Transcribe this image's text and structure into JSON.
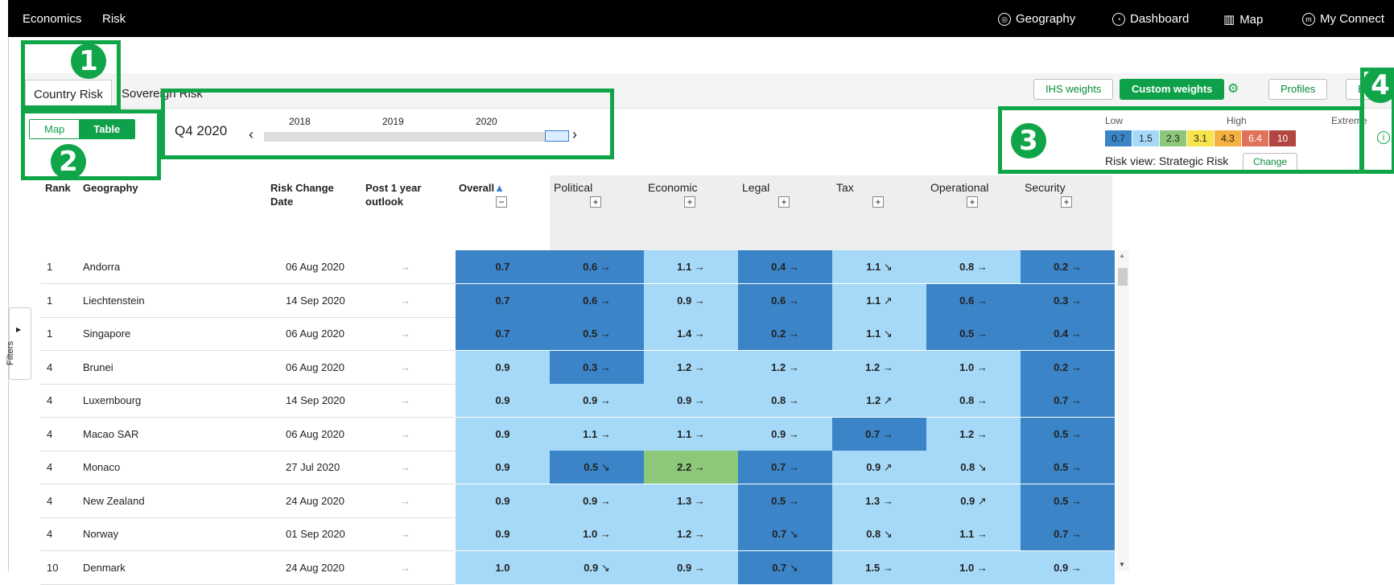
{
  "nav": {
    "left": [
      "Economics",
      "Risk"
    ],
    "right": [
      "Geography",
      "Dashboard",
      "Map",
      "My Connect"
    ]
  },
  "tabs": [
    "Country Risk",
    "Sovereign Risk"
  ],
  "weights": {
    "ihs": "IHS weights",
    "custom": "Custom weights"
  },
  "toolbar_right": {
    "profiles": "Profiles",
    "export": "E"
  },
  "view_toggle": {
    "map": "Map",
    "table": "Table"
  },
  "period": "Q4 2020",
  "timeline_years": [
    "2018",
    "2019",
    "2020"
  ],
  "legend": {
    "low": "Low",
    "high": "High",
    "extreme": "Extreme",
    "values": [
      "0.7",
      "1.5",
      "2.3",
      "3.1",
      "4.3",
      "6.4",
      "10"
    ],
    "colors": [
      "#3b84c8",
      "#a5d9f7",
      "#8cc77a",
      "#f7e34b",
      "#f5b040",
      "#e0745a",
      "#b24640"
    ]
  },
  "risk_view": {
    "label": "Risk view: Strategic Risk",
    "change": "Change"
  },
  "callouts": [
    "1",
    "2",
    "3",
    "4"
  ],
  "filters_label": "Filters",
  "table": {
    "headers": {
      "rank": "Rank",
      "geo": "Geography",
      "date_l1": "Risk Change",
      "date_l2": "Date",
      "post_l1": "Post 1 year",
      "post_l2": "outlook",
      "overall": "Overall"
    },
    "categories": [
      "Political",
      "Economic",
      "Legal",
      "Tax",
      "Operational",
      "Security"
    ],
    "rows": [
      {
        "rank": "1",
        "geo": "Andorra",
        "date": "06 Aug 2020",
        "overall": "0.7",
        "cells": [
          [
            "0.6",
            "→"
          ],
          [
            "1.1",
            "→"
          ],
          [
            "0.4",
            "→"
          ],
          [
            "1.1",
            "↘"
          ],
          [
            "0.8",
            "→"
          ],
          [
            "0.2",
            "→"
          ]
        ]
      },
      {
        "rank": "1",
        "geo": "Liechtenstein",
        "date": "14 Sep 2020",
        "overall": "0.7",
        "cells": [
          [
            "0.6",
            "→"
          ],
          [
            "0.9",
            "→"
          ],
          [
            "0.6",
            "→"
          ],
          [
            "1.1",
            "↗"
          ],
          [
            "0.6",
            "→"
          ],
          [
            "0.3",
            "→"
          ]
        ]
      },
      {
        "rank": "1",
        "geo": "Singapore",
        "date": "06 Aug 2020",
        "overall": "0.7",
        "cells": [
          [
            "0.5",
            "→"
          ],
          [
            "1.4",
            "→"
          ],
          [
            "0.2",
            "→"
          ],
          [
            "1.1",
            "↘"
          ],
          [
            "0.5",
            "→"
          ],
          [
            "0.4",
            "→"
          ]
        ]
      },
      {
        "rank": "4",
        "geo": "Brunei",
        "date": "06 Aug 2020",
        "overall": "0.9",
        "cells": [
          [
            "0.3",
            "→"
          ],
          [
            "1.2",
            "→"
          ],
          [
            "1.2",
            "→"
          ],
          [
            "1.2",
            "→"
          ],
          [
            "1.0",
            "→"
          ],
          [
            "0.2",
            "→"
          ]
        ]
      },
      {
        "rank": "4",
        "geo": "Luxembourg",
        "date": "14 Sep 2020",
        "overall": "0.9",
        "cells": [
          [
            "0.9",
            "→"
          ],
          [
            "0.9",
            "→"
          ],
          [
            "0.8",
            "→"
          ],
          [
            "1.2",
            "↗"
          ],
          [
            "0.8",
            "→"
          ],
          [
            "0.7",
            "→"
          ]
        ]
      },
      {
        "rank": "4",
        "geo": "Macao SAR",
        "date": "06 Aug 2020",
        "overall": "0.9",
        "cells": [
          [
            "1.1",
            "→"
          ],
          [
            "1.1",
            "→"
          ],
          [
            "0.9",
            "→"
          ],
          [
            "0.7",
            "→"
          ],
          [
            "1.2",
            "→"
          ],
          [
            "0.5",
            "→"
          ]
        ]
      },
      {
        "rank": "4",
        "geo": "Monaco",
        "date": "27 Jul 2020",
        "overall": "0.9",
        "cells": [
          [
            "0.5",
            "↘"
          ],
          [
            "2.2",
            "→"
          ],
          [
            "0.7",
            "→"
          ],
          [
            "0.9",
            "↗"
          ],
          [
            "0.8",
            "↘"
          ],
          [
            "0.5",
            "→"
          ]
        ]
      },
      {
        "rank": "4",
        "geo": "New Zealand",
        "date": "24 Aug 2020",
        "overall": "0.9",
        "cells": [
          [
            "0.9",
            "→"
          ],
          [
            "1.3",
            "→"
          ],
          [
            "0.5",
            "→"
          ],
          [
            "1.3",
            "→"
          ],
          [
            "0.9",
            "↗"
          ],
          [
            "0.5",
            "→"
          ]
        ]
      },
      {
        "rank": "4",
        "geo": "Norway",
        "date": "01 Sep 2020",
        "overall": "0.9",
        "cells": [
          [
            "1.0",
            "→"
          ],
          [
            "1.2",
            "→"
          ],
          [
            "0.7",
            "↘"
          ],
          [
            "0.8",
            "↘"
          ],
          [
            "1.1",
            "→"
          ],
          [
            "0.7",
            "→"
          ]
        ]
      },
      {
        "rank": "10",
        "geo": "Denmark",
        "date": "24 Aug 2020",
        "overall": "1.0",
        "cells": [
          [
            "0.9",
            "↘"
          ],
          [
            "0.9",
            "→"
          ],
          [
            "0.7",
            "↘"
          ],
          [
            "1.5",
            "→"
          ],
          [
            "1.0",
            "→"
          ],
          [
            "0.9",
            "→"
          ]
        ]
      }
    ]
  }
}
